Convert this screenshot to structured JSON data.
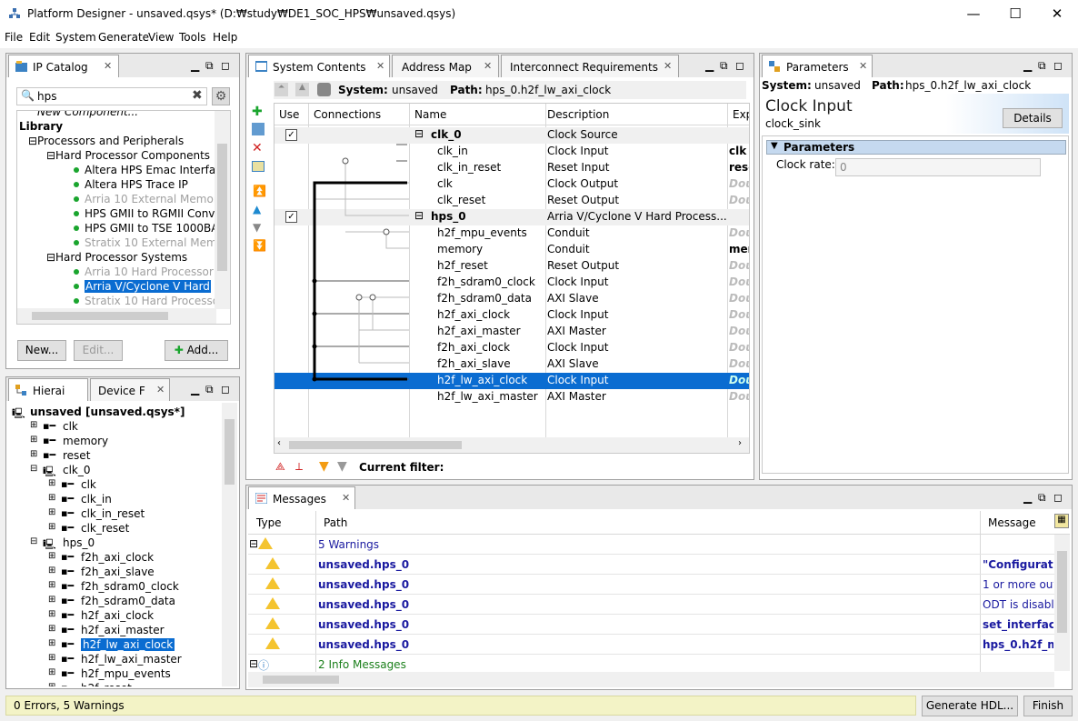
{
  "window": {
    "title": "Platform Designer - unsaved.qsys* (D:₩study₩DE1_SOC_HPS₩unsaved.qsys)",
    "minimize": "—",
    "maximize": "☐",
    "close": "✕"
  },
  "menu": [
    "File",
    "Edit",
    "System",
    "Generate",
    "View",
    "Tools",
    "Help"
  ],
  "ipcatalog": {
    "tab": "IP Catalog",
    "search": "hps",
    "items": [
      {
        "label": "New Component...",
        "style": "italic",
        "indent": 1
      },
      {
        "label": "Library",
        "style": "bold",
        "indent": 0
      },
      {
        "label": "Processors and Peripherals",
        "indent": 1,
        "expander": "⊟"
      },
      {
        "label": "Hard Processor Components",
        "indent": 2,
        "expander": "⊟"
      },
      {
        "label": "Altera HPS Emac Interfa",
        "indent": 3,
        "dot": true
      },
      {
        "label": "Altera HPS Trace IP",
        "indent": 3,
        "dot": true
      },
      {
        "label": "Arria 10 External Memor",
        "indent": 3,
        "dot": true,
        "style": "grey"
      },
      {
        "label": "HPS GMII to RGMII Conv",
        "indent": 3,
        "dot": true
      },
      {
        "label": "HPS GMII to TSE 1000BA",
        "indent": 3,
        "dot": true
      },
      {
        "label": "Stratix 10 External Mem",
        "indent": 3,
        "dot": true,
        "style": "grey"
      },
      {
        "label": "Hard Processor Systems",
        "indent": 2,
        "expander": "⊟"
      },
      {
        "label": "Arria 10 Hard Processor",
        "indent": 3,
        "dot": true,
        "style": "grey"
      },
      {
        "label": "Arria V/Cyclone V Hard",
        "indent": 3,
        "dot": true,
        "selected": true
      },
      {
        "label": "Stratix 10 Hard Processo",
        "indent": 3,
        "dot": true,
        "style": "grey"
      }
    ],
    "new_btn": "New...",
    "edit_btn": "Edit...",
    "add_btn": "Add..."
  },
  "hierarchy": {
    "tab1": "Hierai",
    "tab2": "Device F",
    "items": [
      {
        "label": "unsaved [unsaved.qsys*]",
        "bold": true,
        "indent": 0
      },
      {
        "label": "clk",
        "indent": 1
      },
      {
        "label": "memory",
        "indent": 1
      },
      {
        "label": "reset",
        "indent": 1
      },
      {
        "label": "clk_0",
        "indent": 1,
        "expander": "⊟"
      },
      {
        "label": "clk",
        "indent": 2
      },
      {
        "label": "clk_in",
        "indent": 2
      },
      {
        "label": "clk_in_reset",
        "indent": 2
      },
      {
        "label": "clk_reset",
        "indent": 2
      },
      {
        "label": "hps_0",
        "indent": 1,
        "expander": "⊟"
      },
      {
        "label": "f2h_axi_clock",
        "indent": 2
      },
      {
        "label": "f2h_axi_slave",
        "indent": 2
      },
      {
        "label": "f2h_sdram0_clock",
        "indent": 2
      },
      {
        "label": "f2h_sdram0_data",
        "indent": 2
      },
      {
        "label": "h2f_axi_clock",
        "indent": 2
      },
      {
        "label": "h2f_axi_master",
        "indent": 2
      },
      {
        "label": "h2f_lw_axi_clock",
        "indent": 2,
        "selected": true
      },
      {
        "label": "h2f_lw_axi_master",
        "indent": 2
      },
      {
        "label": "h2f_mpu_events",
        "indent": 2
      },
      {
        "label": "h2f_reset",
        "indent": 2
      }
    ]
  },
  "system": {
    "tabs": [
      "System Contents",
      "Address Map",
      "Interconnect Requirements"
    ],
    "system_label": "System:",
    "system_name": "unsaved",
    "path_label": "Path:",
    "path": "hps_0.h2f_lw_axi_clock",
    "columns": [
      "Use",
      "Connections",
      "Name",
      "Description",
      "Exp"
    ],
    "rows": [
      {
        "name": "clk_0",
        "desc": "Clock Source",
        "exp": "",
        "use": true,
        "bold": true,
        "group": true
      },
      {
        "name": "clk_in",
        "desc": "Clock Input",
        "exp": "clk"
      },
      {
        "name": "clk_in_reset",
        "desc": "Reset Input",
        "exp": "rese"
      },
      {
        "name": "clk",
        "desc": "Clock Output",
        "exp": "Dou"
      },
      {
        "name": "clk_reset",
        "desc": "Reset Output",
        "exp": "Dou"
      },
      {
        "name": "hps_0",
        "desc": "Arria V/Cyclone V Hard Process...",
        "exp": "",
        "use": true,
        "bold": true,
        "group": true
      },
      {
        "name": "h2f_mpu_events",
        "desc": "Conduit",
        "exp": "Dou"
      },
      {
        "name": "memory",
        "desc": "Conduit",
        "exp": "mer"
      },
      {
        "name": "h2f_reset",
        "desc": "Reset Output",
        "exp": "Dou"
      },
      {
        "name": "f2h_sdram0_clock",
        "desc": "Clock Input",
        "exp": "Dou"
      },
      {
        "name": "f2h_sdram0_data",
        "desc": "AXI Slave",
        "exp": "Dou"
      },
      {
        "name": "h2f_axi_clock",
        "desc": "Clock Input",
        "exp": "Dou"
      },
      {
        "name": "h2f_axi_master",
        "desc": "AXI Master",
        "exp": "Dou"
      },
      {
        "name": "f2h_axi_clock",
        "desc": "Clock Input",
        "exp": "Dou"
      },
      {
        "name": "f2h_axi_slave",
        "desc": "AXI Slave",
        "exp": "Dou"
      },
      {
        "name": "h2f_lw_axi_clock",
        "desc": "Clock Input",
        "exp": "Dou",
        "selected": true
      },
      {
        "name": "h2f_lw_axi_master",
        "desc": "AXI Master",
        "exp": "Dou"
      }
    ],
    "filter_label": "Current filter:"
  },
  "parameters": {
    "tab": "Parameters",
    "system_label": "System:",
    "system_name": "unsaved",
    "path_label": "Path:",
    "path": "hps_0.h2f_lw_axi_clock",
    "heading": "Clock Input",
    "subheading": "clock_sink",
    "details_btn": "Details",
    "section": "Parameters",
    "field_label": "Clock rate:",
    "field_value": "0"
  },
  "messages": {
    "tab": "Messages",
    "columns": [
      "Type",
      "Path",
      "Message"
    ],
    "rows": [
      {
        "path": "5 Warnings",
        "msg": "",
        "kind": "group-warn"
      },
      {
        "path": "unsaved.hps_0",
        "msg": "\"Configuratio",
        "kind": "warn"
      },
      {
        "path": "unsaved.hps_0",
        "msg": "1 or more outp",
        "kind": "warn"
      },
      {
        "path": "unsaved.hps_0",
        "msg": "ODT is disable",
        "kind": "warn"
      },
      {
        "path": "unsaved.hps_0",
        "msg": "set_interface",
        "kind": "warn"
      },
      {
        "path": "unsaved.hps_0",
        "msg": "hps_0.h2f_m",
        "kind": "warn"
      },
      {
        "path": "2 Info Messages",
        "msg": "",
        "kind": "group-info"
      }
    ]
  },
  "status": {
    "text": "0 Errors, 5 Warnings",
    "generate_btn": "Generate HDL...",
    "finish_btn": "Finish"
  },
  "colors": {
    "accent": "#0a6cd1",
    "warning": "#f4c430",
    "statusbar": "#f3f3c6"
  }
}
